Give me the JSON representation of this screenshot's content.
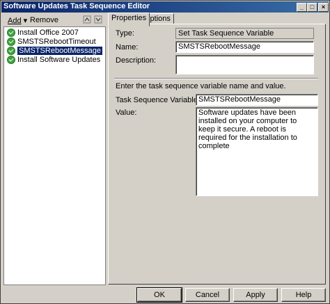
{
  "window": {
    "title": "Software Updates Task Sequence Editor"
  },
  "toolbar": {
    "add_label": "Add",
    "remove_label": "Remove"
  },
  "tree": {
    "items": [
      {
        "label": "Install Office 2007",
        "selected": false
      },
      {
        "label": "SMSTSRebootTimeout",
        "selected": false
      },
      {
        "label": "SMSTSRebootMessage",
        "selected": true
      },
      {
        "label": "Install Software Updates",
        "selected": false
      }
    ]
  },
  "tabs": [
    {
      "label": "Properties",
      "active": true
    },
    {
      "label": "Options",
      "active": false
    }
  ],
  "properties": {
    "type_label": "Type:",
    "type_value": "Set Task Sequence Variable",
    "name_label": "Name:",
    "name_value": "SMSTSRebootMessage",
    "description_label": "Description:",
    "description_value": "",
    "instruction": "Enter the task sequence variable name and value.",
    "variable_label": "Task Sequence Variable:",
    "variable_value": "SMSTSRebootMessage",
    "value_label": "Value:",
    "value_value": "Software updates have been installed on your computer to keep it secure. A reboot is required for the installation to complete"
  },
  "buttons": {
    "ok": "OK",
    "cancel": "Cancel",
    "apply": "Apply",
    "help": "Help"
  },
  "colors": {
    "titlebar": "#0a246a",
    "selection": "#0a246a",
    "success_icon": "#3fa33f"
  }
}
